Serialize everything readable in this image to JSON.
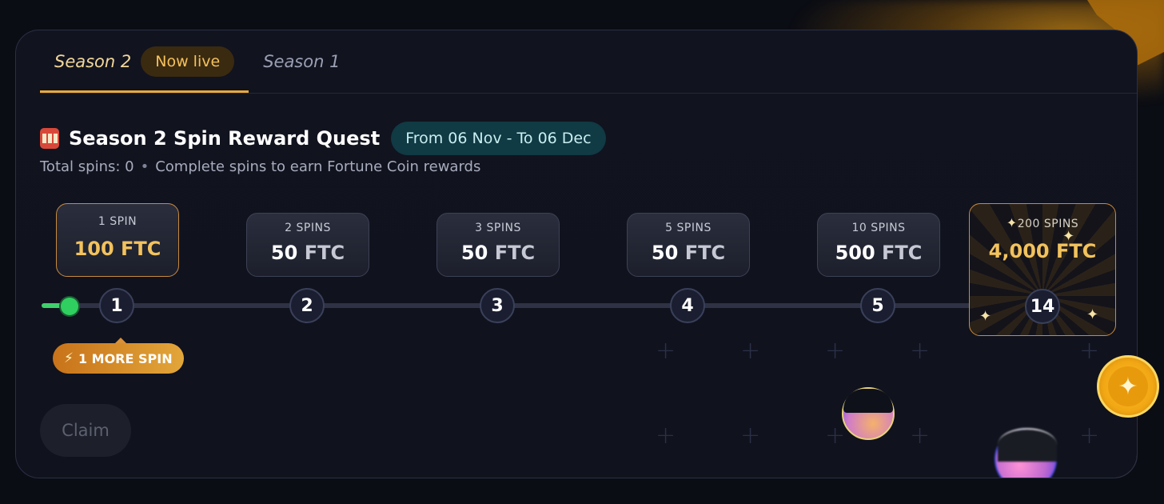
{
  "tabs": [
    {
      "label": "Season 2",
      "badge": "Now live",
      "active": true
    },
    {
      "label": "Season 1",
      "active": false
    }
  ],
  "quest": {
    "title": "Season 2 Spin Reward Quest",
    "date_range": "From 06 Nov - To 06 Dec",
    "total_spins": "Total spins: 0",
    "separator": "•",
    "description": "Complete spins to earn Fortune Coin rewards"
  },
  "rewards": [
    {
      "req": "1 SPIN",
      "amount": "100",
      "unit": "FTC",
      "node": "1",
      "current": true
    },
    {
      "req": "2 SPINS",
      "amount": "50",
      "unit": "FTC",
      "node": "2"
    },
    {
      "req": "3 SPINS",
      "amount": "50",
      "unit": "FTC",
      "node": "3"
    },
    {
      "req": "5 SPINS",
      "amount": "50",
      "unit": "FTC",
      "node": "4"
    },
    {
      "req": "10 SPINS",
      "amount": "500",
      "unit": "FTC",
      "node": "5"
    }
  ],
  "grand_reward": {
    "req": "200 SPINS",
    "amount": "4,000 FTC",
    "node": "14"
  },
  "progress": {
    "fraction": 0.03
  },
  "badge": {
    "text": "1 MORE SPIN"
  },
  "claim": {
    "label": "Claim",
    "enabled": false
  },
  "colors": {
    "accent": "#e8a93a",
    "gold": "#f2c25d",
    "progress": "#2fcf60",
    "date_pill": "#103a44"
  },
  "icons": [
    "slot-machine-icon",
    "lightning-icon",
    "sparkle-icon",
    "coin-icon"
  ]
}
